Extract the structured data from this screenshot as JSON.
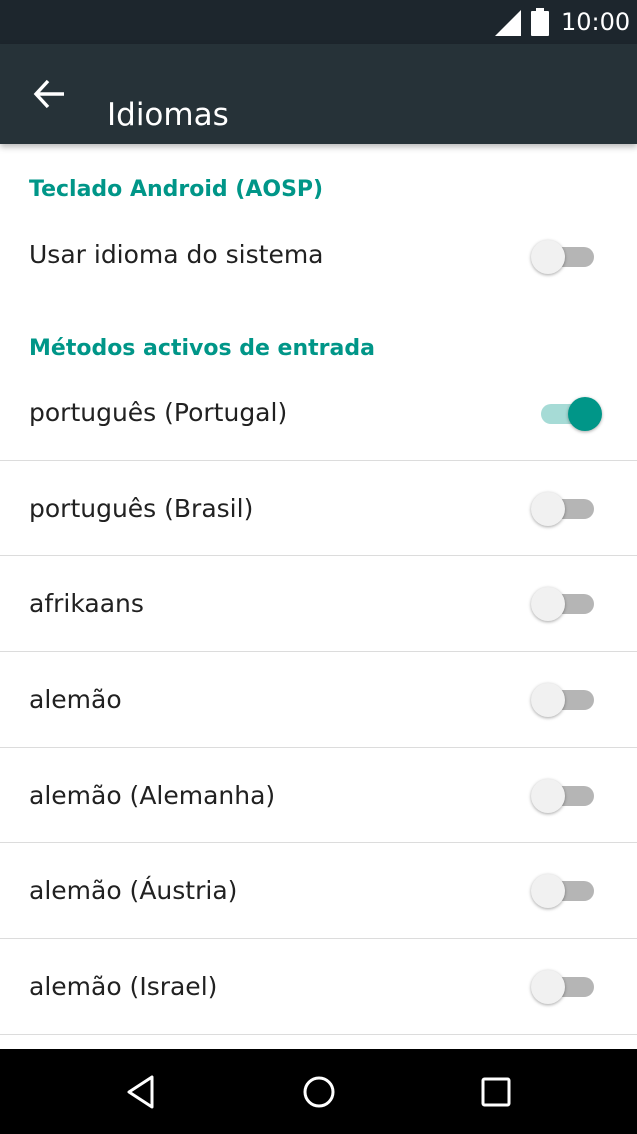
{
  "status_bar": {
    "time": "10:00",
    "icons": [
      "cell-signal-icon",
      "battery-icon"
    ]
  },
  "app_bar": {
    "title": "Idiomas",
    "back_icon": "arrow-back-icon"
  },
  "sections": [
    {
      "header": "Teclado Android (AOSP)",
      "items": [
        {
          "label": "Usar idioma do sistema",
          "enabled": false
        }
      ]
    },
    {
      "header": "Métodos activos de entrada",
      "items": [
        {
          "label": "português (Portugal)",
          "enabled": true
        },
        {
          "label": "português (Brasil)",
          "enabled": false
        },
        {
          "label": "afrikaans",
          "enabled": false
        },
        {
          "label": "alemão",
          "enabled": false
        },
        {
          "label": "alemão (Alemanha)",
          "enabled": false
        },
        {
          "label": "alemão (Áustria)",
          "enabled": false
        },
        {
          "label": "alemão (Israel)",
          "enabled": false
        }
      ]
    }
  ],
  "nav_bar": {
    "buttons": [
      "back-triangle-icon",
      "home-circle-icon",
      "recents-square-icon"
    ]
  },
  "colors": {
    "accent": "#009688",
    "app_bar": "#263238",
    "status_bar": "#1d262d"
  }
}
